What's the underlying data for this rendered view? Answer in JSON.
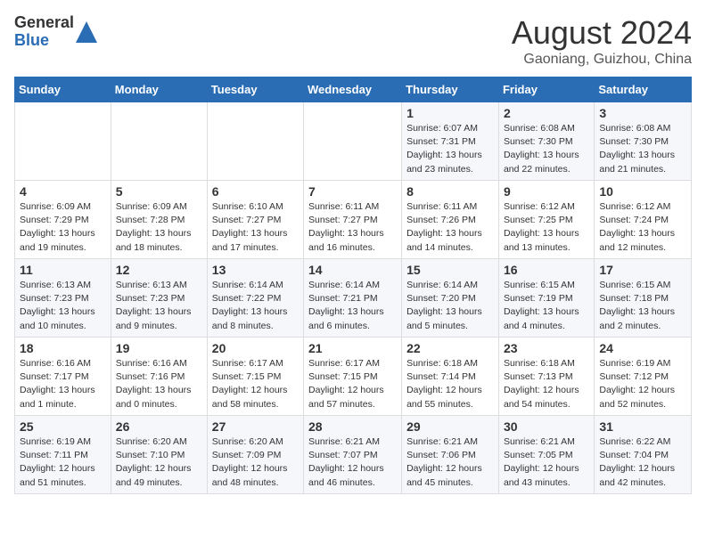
{
  "logo": {
    "general": "General",
    "blue": "Blue"
  },
  "title": "August 2024",
  "location": "Gaoniang, Guizhou, China",
  "days_of_week": [
    "Sunday",
    "Monday",
    "Tuesday",
    "Wednesday",
    "Thursday",
    "Friday",
    "Saturday"
  ],
  "weeks": [
    [
      {
        "day": "",
        "info": ""
      },
      {
        "day": "",
        "info": ""
      },
      {
        "day": "",
        "info": ""
      },
      {
        "day": "",
        "info": ""
      },
      {
        "day": "1",
        "info": "Sunrise: 6:07 AM\nSunset: 7:31 PM\nDaylight: 13 hours and 23 minutes."
      },
      {
        "day": "2",
        "info": "Sunrise: 6:08 AM\nSunset: 7:30 PM\nDaylight: 13 hours and 22 minutes."
      },
      {
        "day": "3",
        "info": "Sunrise: 6:08 AM\nSunset: 7:30 PM\nDaylight: 13 hours and 21 minutes."
      }
    ],
    [
      {
        "day": "4",
        "info": "Sunrise: 6:09 AM\nSunset: 7:29 PM\nDaylight: 13 hours and 19 minutes."
      },
      {
        "day": "5",
        "info": "Sunrise: 6:09 AM\nSunset: 7:28 PM\nDaylight: 13 hours and 18 minutes."
      },
      {
        "day": "6",
        "info": "Sunrise: 6:10 AM\nSunset: 7:27 PM\nDaylight: 13 hours and 17 minutes."
      },
      {
        "day": "7",
        "info": "Sunrise: 6:11 AM\nSunset: 7:27 PM\nDaylight: 13 hours and 16 minutes."
      },
      {
        "day": "8",
        "info": "Sunrise: 6:11 AM\nSunset: 7:26 PM\nDaylight: 13 hours and 14 minutes."
      },
      {
        "day": "9",
        "info": "Sunrise: 6:12 AM\nSunset: 7:25 PM\nDaylight: 13 hours and 13 minutes."
      },
      {
        "day": "10",
        "info": "Sunrise: 6:12 AM\nSunset: 7:24 PM\nDaylight: 13 hours and 12 minutes."
      }
    ],
    [
      {
        "day": "11",
        "info": "Sunrise: 6:13 AM\nSunset: 7:23 PM\nDaylight: 13 hours and 10 minutes."
      },
      {
        "day": "12",
        "info": "Sunrise: 6:13 AM\nSunset: 7:23 PM\nDaylight: 13 hours and 9 minutes."
      },
      {
        "day": "13",
        "info": "Sunrise: 6:14 AM\nSunset: 7:22 PM\nDaylight: 13 hours and 8 minutes."
      },
      {
        "day": "14",
        "info": "Sunrise: 6:14 AM\nSunset: 7:21 PM\nDaylight: 13 hours and 6 minutes."
      },
      {
        "day": "15",
        "info": "Sunrise: 6:14 AM\nSunset: 7:20 PM\nDaylight: 13 hours and 5 minutes."
      },
      {
        "day": "16",
        "info": "Sunrise: 6:15 AM\nSunset: 7:19 PM\nDaylight: 13 hours and 4 minutes."
      },
      {
        "day": "17",
        "info": "Sunrise: 6:15 AM\nSunset: 7:18 PM\nDaylight: 13 hours and 2 minutes."
      }
    ],
    [
      {
        "day": "18",
        "info": "Sunrise: 6:16 AM\nSunset: 7:17 PM\nDaylight: 13 hours and 1 minute."
      },
      {
        "day": "19",
        "info": "Sunrise: 6:16 AM\nSunset: 7:16 PM\nDaylight: 13 hours and 0 minutes."
      },
      {
        "day": "20",
        "info": "Sunrise: 6:17 AM\nSunset: 7:15 PM\nDaylight: 12 hours and 58 minutes."
      },
      {
        "day": "21",
        "info": "Sunrise: 6:17 AM\nSunset: 7:15 PM\nDaylight: 12 hours and 57 minutes."
      },
      {
        "day": "22",
        "info": "Sunrise: 6:18 AM\nSunset: 7:14 PM\nDaylight: 12 hours and 55 minutes."
      },
      {
        "day": "23",
        "info": "Sunrise: 6:18 AM\nSunset: 7:13 PM\nDaylight: 12 hours and 54 minutes."
      },
      {
        "day": "24",
        "info": "Sunrise: 6:19 AM\nSunset: 7:12 PM\nDaylight: 12 hours and 52 minutes."
      }
    ],
    [
      {
        "day": "25",
        "info": "Sunrise: 6:19 AM\nSunset: 7:11 PM\nDaylight: 12 hours and 51 minutes."
      },
      {
        "day": "26",
        "info": "Sunrise: 6:20 AM\nSunset: 7:10 PM\nDaylight: 12 hours and 49 minutes."
      },
      {
        "day": "27",
        "info": "Sunrise: 6:20 AM\nSunset: 7:09 PM\nDaylight: 12 hours and 48 minutes."
      },
      {
        "day": "28",
        "info": "Sunrise: 6:21 AM\nSunset: 7:07 PM\nDaylight: 12 hours and 46 minutes."
      },
      {
        "day": "29",
        "info": "Sunrise: 6:21 AM\nSunset: 7:06 PM\nDaylight: 12 hours and 45 minutes."
      },
      {
        "day": "30",
        "info": "Sunrise: 6:21 AM\nSunset: 7:05 PM\nDaylight: 12 hours and 43 minutes."
      },
      {
        "day": "31",
        "info": "Sunrise: 6:22 AM\nSunset: 7:04 PM\nDaylight: 12 hours and 42 minutes."
      }
    ]
  ]
}
